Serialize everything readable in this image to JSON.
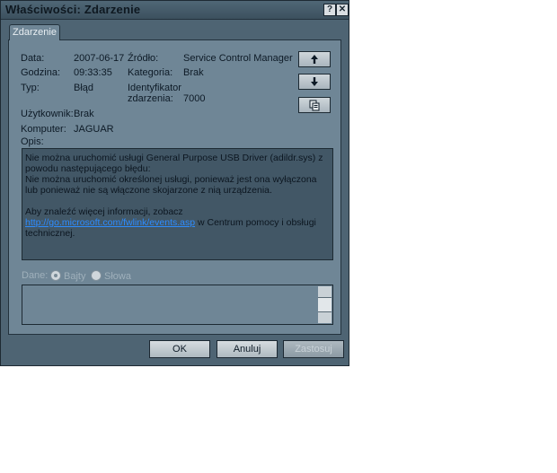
{
  "window": {
    "title": "Właściwości: Zdarzenie",
    "help_glyph": "?",
    "close_glyph": "✕"
  },
  "tab": {
    "label": "Zdarzenie"
  },
  "fields": {
    "date_label": "Data:",
    "date_value": "2007-06-17",
    "source_label": "Źródło:",
    "source_value": "Service Control Manager",
    "time_label": "Godzina:",
    "time_value": "09:33:35",
    "category_label": "Kategoria:",
    "category_value": "Brak",
    "type_label": "Typ:",
    "type_value": "Błąd",
    "event_id_label_1": "Identyfikator",
    "event_id_label_2": "zdarzenia:",
    "event_id_value": "7000",
    "user_label": "Użytkownik:",
    "user_value": "Brak",
    "computer_label": "Komputer:",
    "computer_value": "JAGUAR",
    "description_label": "Opis:"
  },
  "side_buttons": {
    "up_icon": "arrow-up-icon",
    "down_icon": "arrow-down-icon",
    "copy_icon": "copy-icon"
  },
  "description": {
    "line1": "Nie można uruchomić usługi General Purpose USB Driver (adildr.sys) z powodu następującego błędu:",
    "line2": "Nie można uruchomić określonej usługi, ponieważ jest ona wyłączona lub ponieważ nie są włączone skojarzone z nią urządzenia.",
    "more_prefix": "Aby znaleźć więcej informacji, zobacz",
    "link_text": "http://go.microsoft.com/fwlink/events.asp",
    "more_suffix": " w Centrum pomocy i obsługi technicznej."
  },
  "data_section": {
    "label": "Dane:",
    "bytes_label": "Bajty",
    "words_label": "Słowa",
    "selected": "Bajty"
  },
  "buttons": {
    "ok": "OK",
    "cancel": "Anuluj",
    "apply": "Zastosuj"
  }
}
